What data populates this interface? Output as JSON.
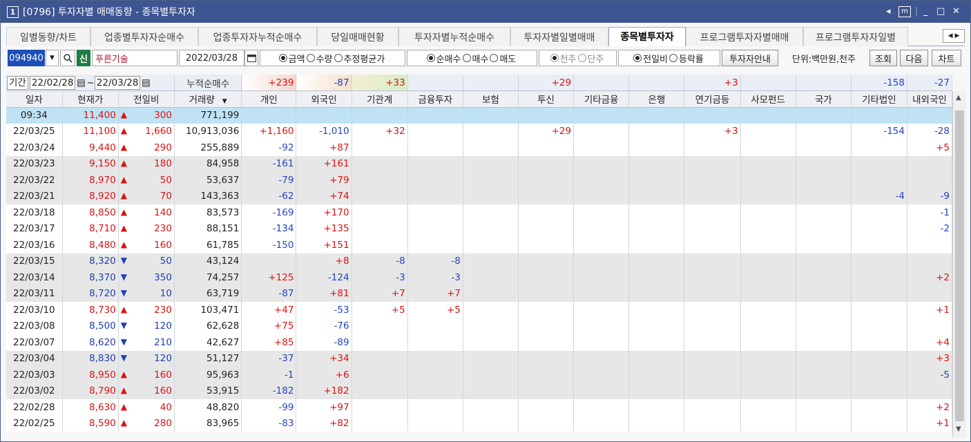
{
  "title": {
    "window_num": "1",
    "text": "[0796] 투자자별 매매동향 - 종목별투자자"
  },
  "tabs": [
    "일별동향/차트",
    "업종별투자자순매수",
    "업종투자자누적순매수",
    "당일매매현황",
    "투자자별누적순매수",
    "투자자별일별매매",
    "종목별투자자",
    "프로그램투자자별매매",
    "프로그램투자자일별"
  ],
  "active_tab_index": 6,
  "toolbar": {
    "code": "094940",
    "new_badge": "신",
    "stock_name": "푸른기술",
    "date": "2022/03/28",
    "radio_amount": "금액",
    "radio_qty": "수량",
    "radio_avg": "추정평균가",
    "radio_net": "순매수",
    "radio_buy": "매수",
    "radio_sell": "매도",
    "radio_thousand": "천주",
    "radio_single": "단주",
    "radio_prev": "전일비",
    "radio_rate": "등락률",
    "btn_guide": "투자자안내",
    "unit": "단위:백만원,천주",
    "btn_query": "조회",
    "btn_next": "다음",
    "btn_chart": "차트"
  },
  "filter": {
    "label": "기간",
    "from": "22/02/28",
    "to": "22/03/28",
    "cumulative_label": "누적순매수"
  },
  "summary": {
    "개인": "+239",
    "외국인": "-87",
    "기관계": "+33",
    "금융투자": "",
    "보험": "",
    "투신": "+29",
    "기타금융": "",
    "은행": "",
    "연기금등": "+3",
    "사모펀드": "",
    "국가": "",
    "기타법인": "-158",
    "내외국인": "-27"
  },
  "columns": [
    "일자",
    "현재가",
    "전일비",
    "거래량",
    "개인",
    "외국인",
    "기관계",
    "금융투자",
    "보험",
    "투신",
    "기타금융",
    "은행",
    "연기금등",
    "사모펀드",
    "국가",
    "기타법인",
    "내외국인"
  ],
  "rows": [
    {
      "date": "09:34",
      "price": "11,400",
      "dir": "up",
      "chg": "300",
      "vol": "771,199",
      "ind": "",
      "for": "",
      "inst": "",
      "fin": "",
      "ins": "",
      "tru": "",
      "oth": "",
      "bank": "",
      "pen": "",
      "pe": "",
      "gov": "",
      "corp": "",
      "dom": ""
    },
    {
      "date": "22/03/25",
      "price": "11,100",
      "dir": "up",
      "chg": "1,660",
      "vol": "10,913,036",
      "ind": "+1,160",
      "for": "-1,010",
      "inst": "+32",
      "fin": "",
      "ins": "",
      "tru": "+29",
      "oth": "",
      "bank": "",
      "pen": "+3",
      "pe": "",
      "gov": "",
      "corp": "-154",
      "dom": "-28"
    },
    {
      "date": "22/03/24",
      "price": "9,440",
      "dir": "up",
      "chg": "290",
      "vol": "255,889",
      "ind": "-92",
      "for": "+87",
      "inst": "",
      "fin": "",
      "ins": "",
      "tru": "",
      "oth": "",
      "bank": "",
      "pen": "",
      "pe": "",
      "gov": "",
      "corp": "",
      "dom": "+5"
    },
    {
      "date": "22/03/23",
      "price": "9,150",
      "dir": "up",
      "chg": "180",
      "vol": "84,958",
      "ind": "-161",
      "for": "+161",
      "inst": "",
      "fin": "",
      "ins": "",
      "tru": "",
      "oth": "",
      "bank": "",
      "pen": "",
      "pe": "",
      "gov": "",
      "corp": "",
      "dom": ""
    },
    {
      "date": "22/03/22",
      "price": "8,970",
      "dir": "up",
      "chg": "50",
      "vol": "53,637",
      "ind": "-79",
      "for": "+79",
      "inst": "",
      "fin": "",
      "ins": "",
      "tru": "",
      "oth": "",
      "bank": "",
      "pen": "",
      "pe": "",
      "gov": "",
      "corp": "",
      "dom": ""
    },
    {
      "date": "22/03/21",
      "price": "8,920",
      "dir": "up",
      "chg": "70",
      "vol": "143,363",
      "ind": "-62",
      "for": "+74",
      "inst": "",
      "fin": "",
      "ins": "",
      "tru": "",
      "oth": "",
      "bank": "",
      "pen": "",
      "pe": "",
      "gov": "",
      "corp": "-4",
      "dom": "-9"
    },
    {
      "date": "22/03/18",
      "price": "8,850",
      "dir": "up",
      "chg": "140",
      "vol": "83,573",
      "ind": "-169",
      "for": "+170",
      "inst": "",
      "fin": "",
      "ins": "",
      "tru": "",
      "oth": "",
      "bank": "",
      "pen": "",
      "pe": "",
      "gov": "",
      "corp": "",
      "dom": "-1"
    },
    {
      "date": "22/03/17",
      "price": "8,710",
      "dir": "up",
      "chg": "230",
      "vol": "88,151",
      "ind": "-134",
      "for": "+135",
      "inst": "",
      "fin": "",
      "ins": "",
      "tru": "",
      "oth": "",
      "bank": "",
      "pen": "",
      "pe": "",
      "gov": "",
      "corp": "",
      "dom": "-2"
    },
    {
      "date": "22/03/16",
      "price": "8,480",
      "dir": "up",
      "chg": "160",
      "vol": "61,785",
      "ind": "-150",
      "for": "+151",
      "inst": "",
      "fin": "",
      "ins": "",
      "tru": "",
      "oth": "",
      "bank": "",
      "pen": "",
      "pe": "",
      "gov": "",
      "corp": "",
      "dom": ""
    },
    {
      "date": "22/03/15",
      "price": "8,320",
      "dir": "dn",
      "chg": "50",
      "vol": "43,124",
      "ind": "",
      "for": "+8",
      "inst": "-8",
      "fin": "-8",
      "ins": "",
      "tru": "",
      "oth": "",
      "bank": "",
      "pen": "",
      "pe": "",
      "gov": "",
      "corp": "",
      "dom": ""
    },
    {
      "date": "22/03/14",
      "price": "8,370",
      "dir": "dn",
      "chg": "350",
      "vol": "74,257",
      "ind": "+125",
      "for": "-124",
      "inst": "-3",
      "fin": "-3",
      "ins": "",
      "tru": "",
      "oth": "",
      "bank": "",
      "pen": "",
      "pe": "",
      "gov": "",
      "corp": "",
      "dom": "+2"
    },
    {
      "date": "22/03/11",
      "price": "8,720",
      "dir": "dn",
      "chg": "10",
      "vol": "63,719",
      "ind": "-87",
      "for": "+81",
      "inst": "+7",
      "fin": "+7",
      "ins": "",
      "tru": "",
      "oth": "",
      "bank": "",
      "pen": "",
      "pe": "",
      "gov": "",
      "corp": "",
      "dom": ""
    },
    {
      "date": "22/03/10",
      "price": "8,730",
      "dir": "up",
      "chg": "230",
      "vol": "103,471",
      "ind": "+47",
      "for": "-53",
      "inst": "+5",
      "fin": "+5",
      "ins": "",
      "tru": "",
      "oth": "",
      "bank": "",
      "pen": "",
      "pe": "",
      "gov": "",
      "corp": "",
      "dom": "+1"
    },
    {
      "date": "22/03/08",
      "price": "8,500",
      "dir": "dn",
      "chg": "120",
      "vol": "62,628",
      "ind": "+75",
      "for": "-76",
      "inst": "",
      "fin": "",
      "ins": "",
      "tru": "",
      "oth": "",
      "bank": "",
      "pen": "",
      "pe": "",
      "gov": "",
      "corp": "",
      "dom": ""
    },
    {
      "date": "22/03/07",
      "price": "8,620",
      "dir": "dn",
      "chg": "210",
      "vol": "42,627",
      "ind": "+85",
      "for": "-89",
      "inst": "",
      "fin": "",
      "ins": "",
      "tru": "",
      "oth": "",
      "bank": "",
      "pen": "",
      "pe": "",
      "gov": "",
      "corp": "",
      "dom": "+4"
    },
    {
      "date": "22/03/04",
      "price": "8,830",
      "dir": "dn",
      "chg": "120",
      "vol": "51,127",
      "ind": "-37",
      "for": "+34",
      "inst": "",
      "fin": "",
      "ins": "",
      "tru": "",
      "oth": "",
      "bank": "",
      "pen": "",
      "pe": "",
      "gov": "",
      "corp": "",
      "dom": "+3"
    },
    {
      "date": "22/03/03",
      "price": "8,950",
      "dir": "up",
      "chg": "160",
      "vol": "95,963",
      "ind": "-1",
      "for": "+6",
      "inst": "",
      "fin": "",
      "ins": "",
      "tru": "",
      "oth": "",
      "bank": "",
      "pen": "",
      "pe": "",
      "gov": "",
      "corp": "",
      "dom": "-5"
    },
    {
      "date": "22/03/02",
      "price": "8,790",
      "dir": "up",
      "chg": "160",
      "vol": "53,915",
      "ind": "-182",
      "for": "+182",
      "inst": "",
      "fin": "",
      "ins": "",
      "tru": "",
      "oth": "",
      "bank": "",
      "pen": "",
      "pe": "",
      "gov": "",
      "corp": "",
      "dom": ""
    },
    {
      "date": "22/02/28",
      "price": "8,630",
      "dir": "up",
      "chg": "40",
      "vol": "48,820",
      "ind": "-99",
      "for": "+97",
      "inst": "",
      "fin": "",
      "ins": "",
      "tru": "",
      "oth": "",
      "bank": "",
      "pen": "",
      "pe": "",
      "gov": "",
      "corp": "",
      "dom": "+2"
    },
    {
      "date": "22/02/25",
      "price": "8,590",
      "dir": "up",
      "chg": "280",
      "vol": "83,965",
      "ind": "-83",
      "for": "+82",
      "inst": "",
      "fin": "",
      "ins": "",
      "tru": "",
      "oth": "",
      "bank": "",
      "pen": "",
      "pe": "",
      "gov": "",
      "corp": "",
      "dom": "+1"
    }
  ],
  "row_shading": [
    "sel",
    "w",
    "w",
    "g",
    "g",
    "g",
    "w",
    "w",
    "w",
    "g",
    "g",
    "g",
    "w",
    "w",
    "w",
    "g",
    "g",
    "g",
    "w",
    "w"
  ],
  "colors": {
    "title_bar": "#3d5591",
    "up": "#d11111",
    "down": "#1f3fb4",
    "selected_row": "#bfe2f4",
    "shaded_row": "#e7e7e7"
  },
  "icons": {
    "up": "▲",
    "down": "▼",
    "calendar": "calendar-icon",
    "search": "search-icon"
  }
}
